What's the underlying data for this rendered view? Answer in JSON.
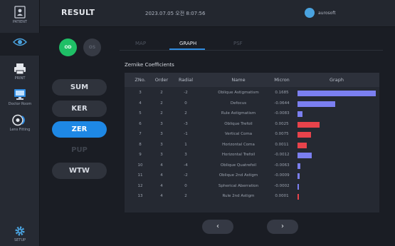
{
  "header": {
    "title": "RESULT",
    "timestamp": "2023.07.05 오전 8:07:56",
    "user": "aurosoft"
  },
  "rail": {
    "items": [
      {
        "label": "PATIENT",
        "icon": "patient-icon"
      },
      {
        "label": "",
        "icon": "eye-icon"
      },
      {
        "label": "PRINT",
        "icon": "print-icon"
      },
      {
        "label": "Doctor Room",
        "icon": "monitor-icon"
      },
      {
        "label": "Lens Fitting",
        "icon": "lens-icon"
      },
      {
        "label": "SETUP",
        "icon": "gear-icon"
      }
    ]
  },
  "eye": {
    "od": "OD",
    "os": "OS",
    "selected": "OD"
  },
  "modes": [
    {
      "label": "SUM",
      "state": "normal"
    },
    {
      "label": "KER",
      "state": "normal"
    },
    {
      "label": "ZER",
      "state": "active"
    },
    {
      "label": "PUP",
      "state": "disabled"
    },
    {
      "label": "WTW",
      "state": "normal"
    }
  ],
  "tabs": [
    {
      "label": "MAP",
      "active": false
    },
    {
      "label": "GRAPH",
      "active": true
    },
    {
      "label": "PSF",
      "active": false
    }
  ],
  "table": {
    "title": "Zernike Coefficients",
    "headers": [
      "ZNo.",
      "Order",
      "Radial",
      "Name",
      "Micron",
      "Graph"
    ],
    "rows": [
      {
        "zno": "3",
        "order": "2",
        "radial": "-2",
        "name": "Oblique Astigmatism",
        "micron": "0.1685"
      },
      {
        "zno": "4",
        "order": "2",
        "radial": "0",
        "name": "Defocus",
        "micron": "-0.0644"
      },
      {
        "zno": "5",
        "order": "2",
        "radial": "2",
        "name": "Rule Astigmatism",
        "micron": "-0.0083"
      },
      {
        "zno": "6",
        "order": "3",
        "radial": "-3",
        "name": "Oblique Trefoil",
        "micron": "0.0025"
      },
      {
        "zno": "7",
        "order": "3",
        "radial": "-1",
        "name": "Vertical Coma",
        "micron": "0.0075"
      },
      {
        "zno": "8",
        "order": "3",
        "radial": "1",
        "name": "Horizontal Coma",
        "micron": "0.0011"
      },
      {
        "zno": "9",
        "order": "3",
        "radial": "3",
        "name": "Horizontal Trefoil",
        "micron": "-0.0012"
      },
      {
        "zno": "10",
        "order": "4",
        "radial": "-4",
        "name": "Oblique Quatrefoil",
        "micron": "-0.0063"
      },
      {
        "zno": "11",
        "order": "4",
        "radial": "-2",
        "name": "Oblique 2nd Astigm",
        "micron": "-0.0009"
      },
      {
        "zno": "12",
        "order": "4",
        "radial": "0",
        "name": "Spherical Aberration",
        "micron": "-0.0002"
      },
      {
        "zno": "13",
        "order": "4",
        "radial": "2",
        "name": "Rule 2nd Astigm",
        "micron": "0.0001"
      }
    ],
    "bars": [
      {
        "level": 1.0,
        "color": "#7b7ff0"
      },
      {
        "level": 0.48,
        "color": "#7b7ff0"
      },
      {
        "level": 0.06,
        "color": "#7b7ff0"
      },
      {
        "level": 0.28,
        "color": "#e8434b"
      },
      {
        "level": 0.17,
        "color": "#e8434b"
      },
      {
        "level": 0.12,
        "color": "#e8434b"
      },
      {
        "level": 0.18,
        "color": "#7b7ff0"
      },
      {
        "level": 0.04,
        "color": "#7b7ff0"
      },
      {
        "level": 0.03,
        "color": "#7b7ff0"
      },
      {
        "level": 0.02,
        "color": "#7b7ff0"
      },
      {
        "level": 0.01,
        "color": "#e8434b"
      }
    ]
  },
  "pager": {
    "prev": "‹",
    "next": "›"
  },
  "colors": {
    "accent": "#1e88e5",
    "od": "#1fbf66",
    "positive": "#7b7ff0",
    "negative": "#e8434b"
  }
}
